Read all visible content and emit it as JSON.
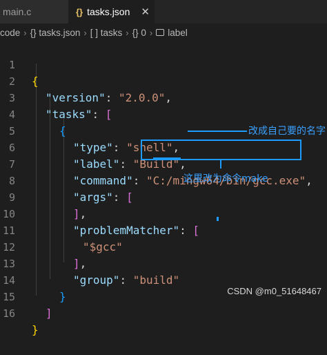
{
  "tabs": [
    {
      "label": "main.c",
      "icon": "c-file-icon"
    },
    {
      "label": "tasks.json",
      "icon": "json-braces-icon",
      "close": "✕"
    }
  ],
  "breadcrumb": {
    "items": [
      "code",
      "{} tasks.json",
      "[ ] tasks",
      "{} 0",
      "label"
    ]
  },
  "lines": [
    {
      "n": "1"
    },
    {
      "n": "2"
    },
    {
      "n": "3"
    },
    {
      "n": "4"
    },
    {
      "n": "5"
    },
    {
      "n": "6"
    },
    {
      "n": "7"
    },
    {
      "n": "8"
    },
    {
      "n": "9"
    },
    {
      "n": "10"
    },
    {
      "n": "11"
    },
    {
      "n": "12"
    },
    {
      "n": "13"
    },
    {
      "n": "14"
    },
    {
      "n": "15"
    },
    {
      "n": "16"
    }
  ],
  "code": {
    "open_brace": "{",
    "version_key": "\"version\"",
    "version_val": "\"2.0.0\"",
    "tasks_key": "\"tasks\"",
    "tasks_open": "[",
    "obj_open": "{",
    "type_key": "\"type\"",
    "type_val": "\"shell\"",
    "label_key": "\"label\"",
    "label_val": "\"Build\"",
    "command_key": "\"command\"",
    "command_val": "\"C:/mingw64/bin/gcc.exe\"",
    "args_key": "\"args\"",
    "args_open": "[",
    "args_close": "]",
    "pm_key": "\"problemMatcher\"",
    "pm_open": "[",
    "pm_val": "\"$gcc\"",
    "pm_close": "]",
    "group_key": "\"group\"",
    "group_val": "\"build\"",
    "obj_close": "}",
    "tasks_close": "]",
    "close_brace": "}"
  },
  "annotations": {
    "label_note": "改成自己要的名字",
    "command_note": "这里改为命令make"
  },
  "watermark": "CSDN @m0_51648467",
  "colors": {
    "annotation": "#3aa0ff",
    "key": "#9cdcfe",
    "string": "#ce9178",
    "brace": "#ffd700",
    "bracket": "#da70d6"
  }
}
